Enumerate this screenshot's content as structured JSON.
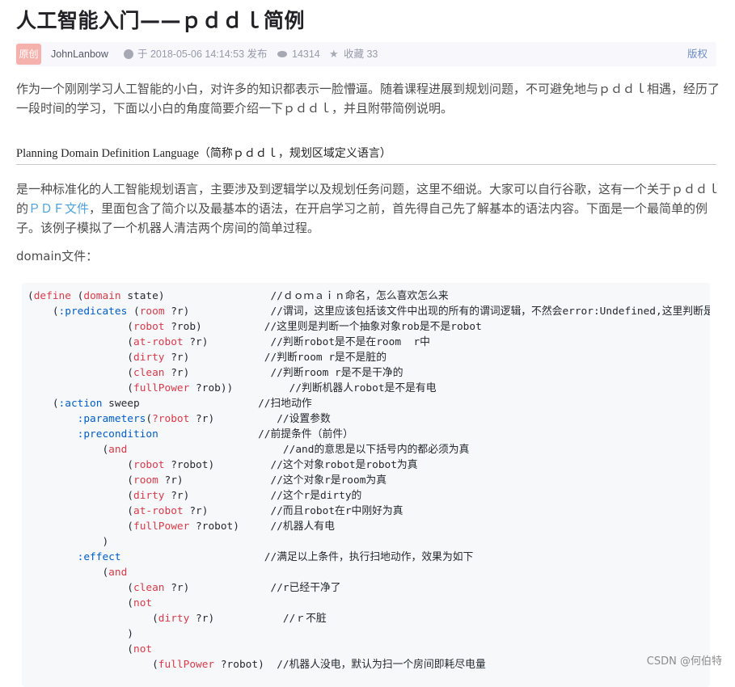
{
  "article": {
    "title": "人工智能入门——ｐｄｄｌ简例",
    "badge": "原创",
    "author": "JohnLanbow",
    "published": "于 2018-05-06 14:14:53 发布",
    "views": "14314",
    "favorites": "收藏 33",
    "copyright": "版权",
    "intro": "作为一个刚刚学习人工智能的小白，对许多的知识都表示一脸懵逼。随着课程进展到规划问题，不可避免地与ｐｄｄｌ相遇，经历了一段时间的学习，下面以小白的角度简要介绍一下ｐｄｄｌ，并且附带简例说明。",
    "section_heading_en": "Planning Domain Definition Language",
    "section_heading_cn": "（简称ｐｄｄｌ，规划区域定义语言）",
    "body_part1": "是一种标准化的人工智能规划语言，主要涉及到逻辑学以及规划任务问题，这里不细说。大家可以自行谷歌，这有一个关于ｐｄｄｌ的",
    "body_link": "ＰＤＦ文件",
    "body_part2": "，里面包含了简介以及最基本的语法，在开启学习之前，首先得自己先了解基本的语法内容。下面是一个最简单的例子。该例子模拟了一个机器人清洁两个房间的简单过程。",
    "domain_label": "domain文件："
  },
  "code": {
    "lines": [
      [
        [
          "p",
          "("
        ],
        [
          "k",
          "define"
        ],
        [
          "p",
          " ("
        ],
        [
          "k",
          "domain"
        ],
        [
          "p",
          " state)                 "
        ],
        [
          "c",
          "//ｄｏｍａｉｎ命名，怎么喜欢怎么来"
        ]
      ],
      [
        [
          "p",
          "    ("
        ],
        [
          "d",
          ":predicates"
        ],
        [
          "p",
          " ("
        ],
        [
          "k",
          "room"
        ],
        [
          "p",
          " ?r)             "
        ],
        [
          "c",
          "//谓词，这里应该包括该文件中出现的所有的谓词逻辑，不然会error:Undefined,这里判断是不"
        ]
      ],
      [
        [
          "p",
          "                ("
        ],
        [
          "k",
          "robot"
        ],
        [
          "p",
          " ?rob)          "
        ],
        [
          "c",
          "//这里则是判断一个抽象对象rob是不是robot"
        ]
      ],
      [
        [
          "p",
          "                ("
        ],
        [
          "k",
          "at-robot"
        ],
        [
          "p",
          " ?r)          "
        ],
        [
          "c",
          "//判断robot是不是在room  r中"
        ]
      ],
      [
        [
          "p",
          "                ("
        ],
        [
          "k",
          "dirty"
        ],
        [
          "p",
          " ?r)            "
        ],
        [
          "c",
          "//判断room r是不是脏的"
        ]
      ],
      [
        [
          "p",
          "                ("
        ],
        [
          "k",
          "clean"
        ],
        [
          "p",
          " ?r)             "
        ],
        [
          "c",
          "//判断room r是不是干净的"
        ]
      ],
      [
        [
          "p",
          "                ("
        ],
        [
          "k",
          "fullPower"
        ],
        [
          "p",
          " ?rob))         "
        ],
        [
          "c",
          "//判断机器人robot是不是有电"
        ]
      ],
      [
        [
          "p",
          "    ("
        ],
        [
          "d",
          ":action"
        ],
        [
          "p",
          " sweep                   "
        ],
        [
          "c",
          "//扫地动作"
        ]
      ],
      [
        [
          "p",
          "        "
        ],
        [
          "d",
          ":parameters"
        ],
        [
          "p",
          "("
        ],
        [
          "k",
          "?robot"
        ],
        [
          "p",
          " ?r)          "
        ],
        [
          "c",
          "//设置参数"
        ]
      ],
      [
        [
          "p",
          "        "
        ],
        [
          "d",
          ":precondition"
        ],
        [
          "p",
          "                "
        ],
        [
          "c",
          "//前提条件（前件）"
        ]
      ],
      [
        [
          "p",
          "            ("
        ],
        [
          "k",
          "and"
        ],
        [
          "p",
          "                         "
        ],
        [
          "c",
          "//and的意思是以下括号内的都必须为真"
        ]
      ],
      [
        [
          "p",
          "                ("
        ],
        [
          "k",
          "robot"
        ],
        [
          "p",
          " ?robot)         "
        ],
        [
          "c",
          "//这个对象robot是robot为真"
        ]
      ],
      [
        [
          "p",
          "                ("
        ],
        [
          "k",
          "room"
        ],
        [
          "p",
          " ?r)              "
        ],
        [
          "c",
          "//这个对象r是room为真"
        ]
      ],
      [
        [
          "p",
          "                ("
        ],
        [
          "k",
          "dirty"
        ],
        [
          "p",
          " ?r)             "
        ],
        [
          "c",
          "//这个r是dirty的"
        ]
      ],
      [
        [
          "p",
          "                ("
        ],
        [
          "k",
          "at-robot"
        ],
        [
          "p",
          " ?r)          "
        ],
        [
          "c",
          "//而且robot在r中刚好为真"
        ]
      ],
      [
        [
          "p",
          "                ("
        ],
        [
          "k",
          "fullPower"
        ],
        [
          "p",
          " ?robot)     "
        ],
        [
          "c",
          "//机器人有电"
        ]
      ],
      [
        [
          "p",
          "            )"
        ]
      ],
      [
        [
          "p",
          "        "
        ],
        [
          "d",
          ":effect"
        ],
        [
          "p",
          "                       "
        ],
        [
          "c",
          "//满足以上条件，执行扫地动作，效果为如下"
        ]
      ],
      [
        [
          "p",
          "            ("
        ],
        [
          "k",
          "and"
        ]
      ],
      [
        [
          "p",
          "                ("
        ],
        [
          "k",
          "clean"
        ],
        [
          "p",
          " ?r)             "
        ],
        [
          "c",
          "//r已经干净了"
        ]
      ],
      [
        [
          "p",
          "                ("
        ],
        [
          "k",
          "not"
        ]
      ],
      [
        [
          "p",
          "                    ("
        ],
        [
          "k",
          "dirty"
        ],
        [
          "p",
          " ?r)           "
        ],
        [
          "c",
          "//ｒ不脏"
        ]
      ],
      [
        [
          "p",
          "                )"
        ]
      ],
      [
        [
          "p",
          "                ("
        ],
        [
          "k",
          "not"
        ]
      ],
      [
        [
          "p",
          "                    ("
        ],
        [
          "k",
          "fullPower"
        ],
        [
          "p",
          " ?robot)  "
        ],
        [
          "c",
          "//机器人没电，默认为扫一个房间即耗尽电量"
        ]
      ]
    ]
  },
  "watermark": "CSDN @何伯特"
}
